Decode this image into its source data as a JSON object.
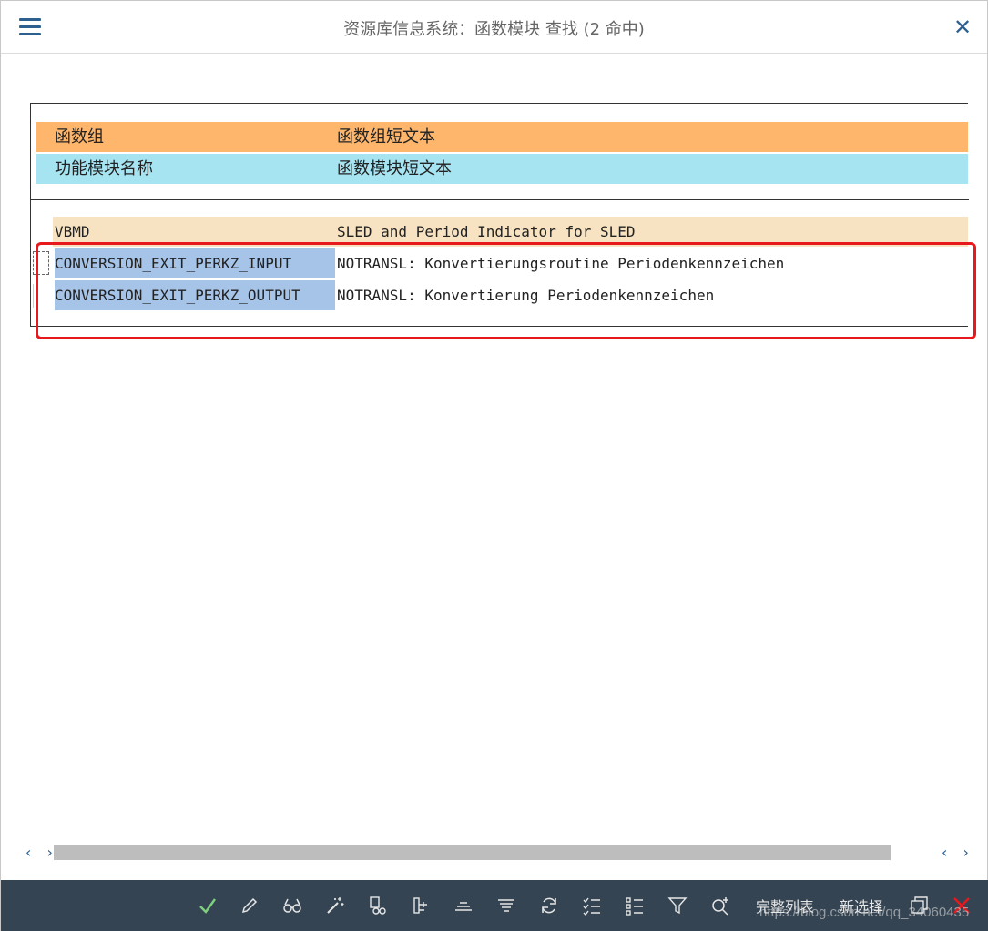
{
  "window": {
    "title": "资源库信息系统：函数模块 查找 (2 命中)"
  },
  "list": {
    "header_group": {
      "col1": "函数组",
      "col2": "函数组短文本",
      "color": "#fdb66c"
    },
    "header_module": {
      "col1": "功能模块名称",
      "col2": "函数模块短文本",
      "color": "#a6e4f2"
    },
    "group_row": {
      "col1": "VBMD",
      "col2": "SLED and Period Indicator for SLED"
    },
    "rows": [
      {
        "name": "CONVERSION_EXIT_PERKZ_INPUT",
        "text": "NOTRANSL: Konvertierungsroutine Periodenkennzeichen"
      },
      {
        "name": "CONVERSION_EXIT_PERKZ_OUTPUT",
        "text": "NOTRANSL: Konvertierung Periodenkennzeichen"
      }
    ]
  },
  "scroll": {
    "left": "‹ ›",
    "right": "‹ ›"
  },
  "toolbar": {
    "full_list_label": "完整列表",
    "new_selection_label": "新选择"
  },
  "watermark": "https://blog.csdn.net/qq_34060435",
  "colors": {
    "toolbar_bg": "#354452",
    "accent": "#2d5f8f",
    "highlight": "#e8191d"
  }
}
